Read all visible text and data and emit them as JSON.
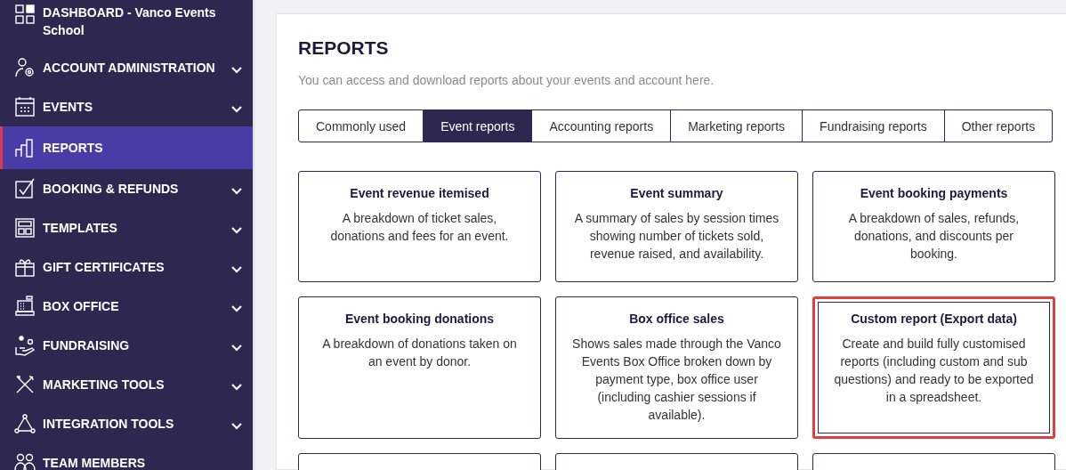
{
  "sidebar": {
    "items": [
      {
        "label": "DASHBOARD - Vanco Events School",
        "expandable": false,
        "selected": false
      },
      {
        "label": "ACCOUNT ADMINISTRATION",
        "expandable": true,
        "selected": false
      },
      {
        "label": "EVENTS",
        "expandable": true,
        "selected": false
      },
      {
        "label": "REPORTS",
        "expandable": false,
        "selected": true
      },
      {
        "label": "BOOKING & REFUNDS",
        "expandable": true,
        "selected": false
      },
      {
        "label": "TEMPLATES",
        "expandable": true,
        "selected": false
      },
      {
        "label": "GIFT CERTIFICATES",
        "expandable": true,
        "selected": false
      },
      {
        "label": "BOX OFFICE",
        "expandable": true,
        "selected": false
      },
      {
        "label": "FUNDRAISING",
        "expandable": true,
        "selected": false
      },
      {
        "label": "MARKETING TOOLS",
        "expandable": true,
        "selected": false
      },
      {
        "label": "INTEGRATION TOOLS",
        "expandable": true,
        "selected": false
      },
      {
        "label": "TEAM MEMBERS",
        "expandable": false,
        "selected": false
      }
    ]
  },
  "page": {
    "title": "REPORTS",
    "subtitle": "You can access and download reports about your events and account here."
  },
  "tabs": [
    {
      "label": "Commonly used",
      "selected": false
    },
    {
      "label": "Event reports",
      "selected": true
    },
    {
      "label": "Accounting reports",
      "selected": false
    },
    {
      "label": "Marketing reports",
      "selected": false
    },
    {
      "label": "Fundraising reports",
      "selected": false
    },
    {
      "label": "Other reports",
      "selected": false
    }
  ],
  "cards": [
    {
      "title": "Event revenue itemised",
      "description": "A breakdown of ticket sales, donations and fees for an event.",
      "highlighted": false
    },
    {
      "title": "Event summary",
      "description": "A summary of sales by session times showing number of tickets sold, revenue raised, and availability.",
      "highlighted": false
    },
    {
      "title": "Event booking payments",
      "description": "A breakdown of sales, refunds, donations, and discounts per booking.",
      "highlighted": false
    },
    {
      "title": "Event booking donations",
      "description": "A breakdown of donations taken on an event by donor.",
      "highlighted": false
    },
    {
      "title": "Box office sales",
      "description": "Shows sales made through the Vanco Events Box Office broken down by payment type, box office user (including cashier sessions if available).",
      "highlighted": false
    },
    {
      "title": "Custom report (Export data)",
      "description": "Create and build fully customised reports (including custom and sub questions) and ready to be exported in a spreadsheet.",
      "highlighted": true
    }
  ]
}
